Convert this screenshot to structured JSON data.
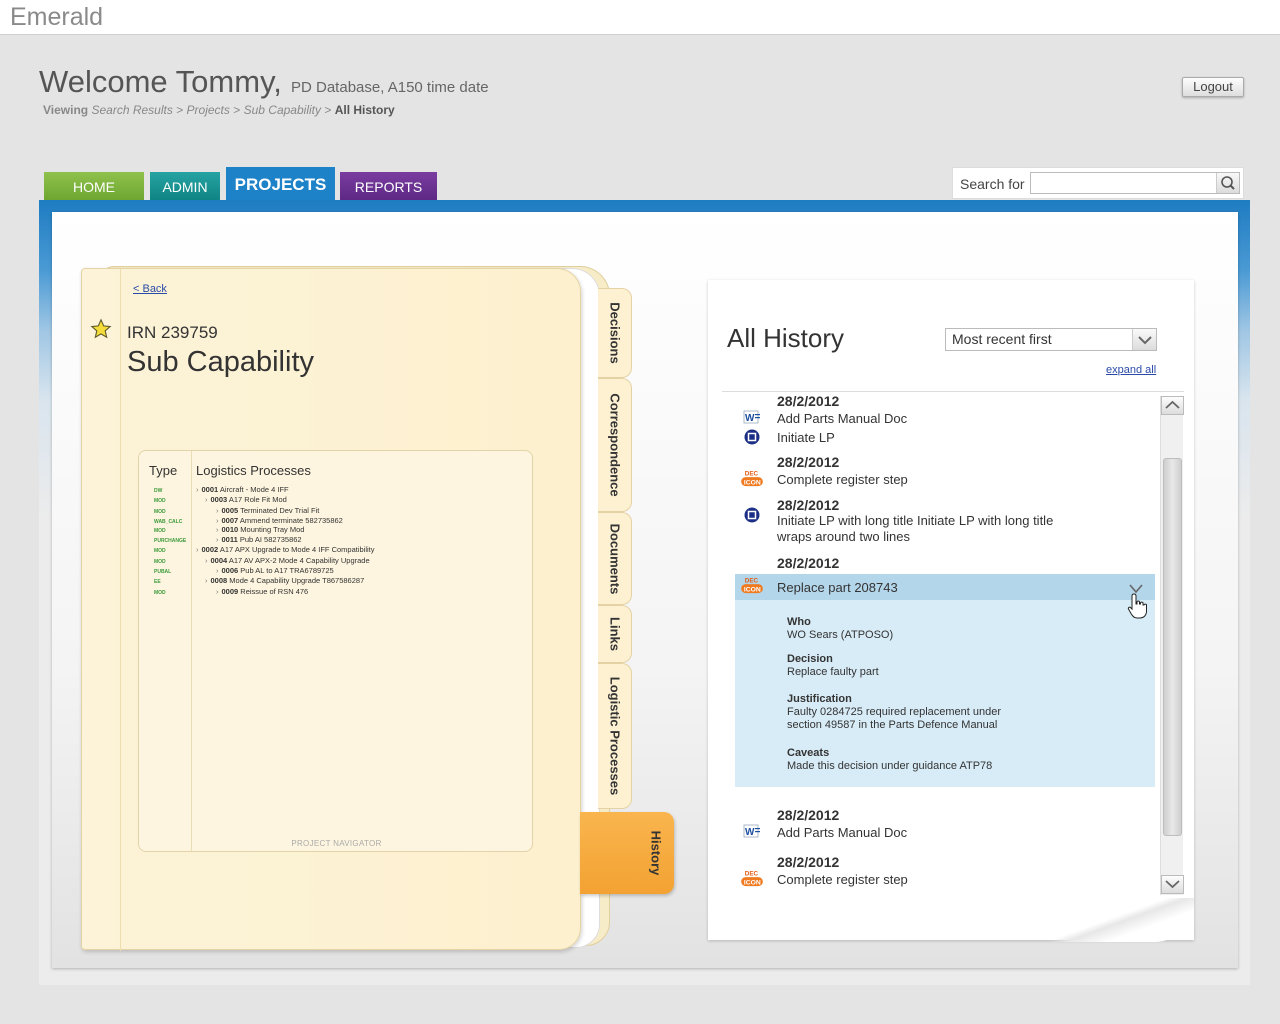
{
  "app": {
    "brand": "Emerald"
  },
  "header": {
    "welcome": "Welcome Tommy,",
    "subtitle": "PD Database, A150 time date",
    "breadcrumb": {
      "viewing": "Viewing",
      "search_results": "Search Results",
      "sep": ">",
      "projects": "Projects",
      "sub_capability": "Sub Capability",
      "current": "All History"
    },
    "logout_label": "Logout"
  },
  "nav": {
    "tabs": [
      {
        "label": "HOME"
      },
      {
        "label": "ADMIN"
      },
      {
        "label": "PROJECTS"
      },
      {
        "label": "REPORTS"
      }
    ]
  },
  "search": {
    "label": "Search for",
    "value": "",
    "placeholder": ""
  },
  "project": {
    "back_label": "< Back",
    "irn": "IRN 239759",
    "title": "Sub Capability",
    "navigator": {
      "type_header": "Type",
      "title": "Logistics Processes",
      "footer": "PROJECT NAVIGATOR",
      "types": [
        "DW",
        "MOD",
        "MOD",
        "WAB_CALC",
        "MOD",
        "PURCHANGE",
        "MOD",
        "MOD",
        "PUBAL",
        "EE",
        "MOD"
      ],
      "items": [
        {
          "code": "0001",
          "name": "Aircraft - Mode 4 IFF"
        },
        {
          "code": "0003",
          "name": "A17 Role Fit Mod"
        },
        {
          "code": "0005",
          "name": "Terminated Dev Trial Fit"
        },
        {
          "code": "0007",
          "name": "Ammend terminate 582735862"
        },
        {
          "code": "0010",
          "name": "Mounting Tray Mod"
        },
        {
          "code": "0011",
          "name": "Pub AI 582735862"
        },
        {
          "code": "0002",
          "name": "A17 APX Upgrade to Mode 4 IFF Compatibility"
        },
        {
          "code": "0004",
          "name": "A17 AV APX-2 Mode 4 Capability Upgrade"
        },
        {
          "code": "0006",
          "name": "Pub AL to A17 TRA6789725"
        },
        {
          "code": "0008",
          "name": "Mode 4 Capability Upgrade T867586287"
        },
        {
          "code": "0009",
          "name": "Reissue of RSN 476"
        }
      ]
    },
    "side_tabs": [
      "Decisions",
      "Correspondence",
      "Documents",
      "Links",
      "Logistic Processes",
      "History"
    ]
  },
  "history": {
    "title": "All History",
    "sort": {
      "selected": "Most recent first"
    },
    "expand_all": "expand all",
    "entries": [
      {
        "date": "28/2/2012",
        "items": [
          "Add Parts Manual Doc",
          "Initiate LP"
        ]
      },
      {
        "date": "28/2/2012",
        "items": [
          "Complete register step"
        ]
      },
      {
        "date": "28/2/2012",
        "items": [
          "Initiate LP with long title Initiate LP with long title wraps around two lines"
        ]
      },
      {
        "date": "28/2/2012",
        "items": [
          "Replace part 208743"
        ]
      },
      {
        "date": "28/2/2012",
        "items": [
          "Add Parts Manual Doc"
        ]
      },
      {
        "date": "28/2/2012",
        "items": [
          "Complete register step"
        ]
      }
    ],
    "detail": {
      "who_label": "Who",
      "who": "WO Sears (ATPOSO)",
      "decision_label": "Decision",
      "decision": "Replace faulty part",
      "justification_label": "Justification",
      "justification": "Faulty 0284725 required replacement under section 49587 in the Parts Defence Manual",
      "caveats_label": "Caveats",
      "caveats": "Made this decision under guidance ATP78"
    },
    "icon_text": {
      "dec": "DEC",
      "icon": "ICON",
      "word": "W"
    }
  },
  "colors": {
    "home": "#7cb342",
    "admin": "#1a9696",
    "projects": "#1e82c8",
    "reports": "#6a3196",
    "folder": "#fdf0ce",
    "history_tab": "#f7a83c",
    "expanded_bg": "#d8ecf7",
    "expanded_head": "#b4d6ea"
  }
}
